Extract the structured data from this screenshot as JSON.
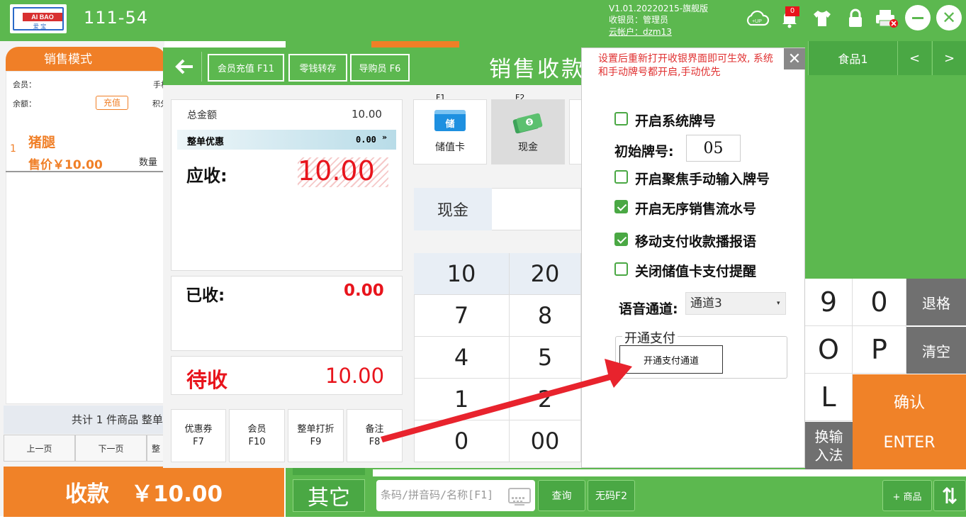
{
  "topbar": {
    "logo_text": "AI BAO",
    "logo_sub": "爱 宝",
    "store_code": "111-54",
    "version": "V1.01.20220215-旗舰版",
    "cashier": "收银员：管理员",
    "cloud_account": "云帐户：dzm13",
    "notification_count": "0"
  },
  "left": {
    "tab_label": "销售模式",
    "member_label": "会员：",
    "phone_label": "手机",
    "balance_label": "余额：",
    "points_label": "积分",
    "recharge_label": "充值",
    "item": {
      "index": "1",
      "name": "猪腿",
      "price": "售价￥10.00",
      "qty_label": "数量"
    },
    "summary": "共计 1 件商品 整单",
    "prev_page": "上一页",
    "next_page": "下一页",
    "page_whole": "整",
    "pay_button": "收款　￥10.00"
  },
  "dialog": {
    "header_buttons": [
      "会员充值 F11",
      "零钱转存",
      "导购员 F6"
    ],
    "title": "销售收款",
    "total_label": "总金额",
    "total_value": "10.00",
    "discount_label": "整单优惠",
    "discount_value": "0.00",
    "due_label": "应收:",
    "due_value": "10.00",
    "received_label": "已收:",
    "received_value": "0.00",
    "pending_label": "待收",
    "pending_value": "10.00",
    "func_buttons": [
      {
        "label": "优惠券",
        "key": "F7"
      },
      {
        "label": "会员",
        "key": "F10"
      },
      {
        "label": "整单打折",
        "key": "F9"
      },
      {
        "label": "备注",
        "key": "F8"
      }
    ],
    "payments": [
      {
        "key": "F1",
        "label": "储值卡",
        "icon_text": "储"
      },
      {
        "key": "F2",
        "label": "现金"
      }
    ],
    "cash_label": "现金",
    "numpad": [
      "10",
      "20",
      "7",
      "8",
      "4",
      "5",
      "1",
      "2",
      "0",
      "00"
    ]
  },
  "settings": {
    "note": "设置后重新打开收银界面即可生效, 系统和手动牌号都开启,手动优先",
    "opt_system_no": "开启系统牌号",
    "start_no_label": "初始牌号:",
    "start_no_value": "05",
    "opt_focus_manual": "开启聚焦手动输入牌号",
    "opt_unordered": "开启无序销售流水号",
    "opt_voice": "移动支付收款播报语",
    "opt_close_card": "关闭储值卡支付提醒",
    "voice_channel_label": "语音通道:",
    "voice_channel_value": "通道3",
    "pay_group_label": "开通支付",
    "open_pay_button": "开通支付通道",
    "checked": {
      "system_no": false,
      "focus_manual": false,
      "unordered": true,
      "voice": true,
      "close_card": false
    }
  },
  "right": {
    "food_tab": "食品1",
    "prev": "<",
    "next": ">",
    "keys": {
      "nine": "9",
      "zero": "0",
      "o": "O",
      "p": "P",
      "l": "L"
    },
    "backspace": "退格",
    "clear": "清空",
    "switch_ime": "换输入法",
    "confirm": "确认",
    "enter": "ENTER",
    "other": "其它",
    "search_placeholder": "条码/拼音码/名称[F1]",
    "query": "查询",
    "no_code": "无码F2",
    "add_goods": "+ 商品"
  },
  "colors": {
    "green": "#5cb84f",
    "orange": "#f08228",
    "red": "#e8141c"
  }
}
